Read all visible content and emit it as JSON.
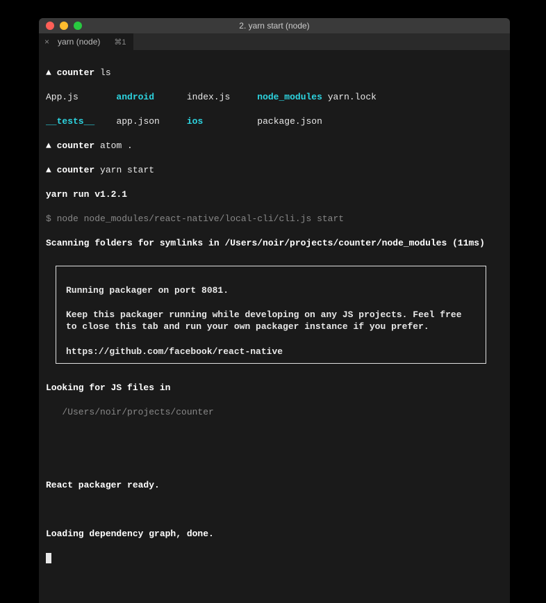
{
  "window": {
    "title": "2. yarn start (node)"
  },
  "tab": {
    "label": "yarn (node)",
    "shortcut": "⌘1",
    "close": "×"
  },
  "prompt1": {
    "symbol": "▲",
    "dir": "counter",
    "cmd": "ls"
  },
  "ls": {
    "c1r1": "App.js",
    "c1r2": "__tests__",
    "c2r1": "android",
    "c2r2": "app.json",
    "c3r1": "index.js",
    "c3r2": "ios",
    "c4r1": "node_modules",
    "c4r2": "package.json",
    "c5r1": "yarn.lock"
  },
  "prompt2": {
    "symbol": "▲",
    "dir": "counter",
    "cmd": "atom ."
  },
  "prompt3": {
    "symbol": "▲",
    "dir": "counter",
    "cmd": "yarn start"
  },
  "yarn": {
    "run": "yarn run v1.2.1",
    "node_line_prefix": "$ ",
    "node_line": "node node_modules/react-native/local-cli/cli.js start",
    "scan": "Scanning folders for symlinks in /Users/noir/projects/counter/node_modules (11ms)"
  },
  "box": {
    "line1": "Running packager on port 8081.",
    "line2": "Keep this packager running while developing on any JS projects. Feel free to close this tab and run your own packager instance if you prefer.",
    "line3": "https://github.com/facebook/react-native"
  },
  "tail": {
    "looking": "Looking for JS files in",
    "path": "   /Users/noir/projects/counter",
    "ready": "React packager ready.",
    "loading": "Loading dependency graph, done."
  }
}
